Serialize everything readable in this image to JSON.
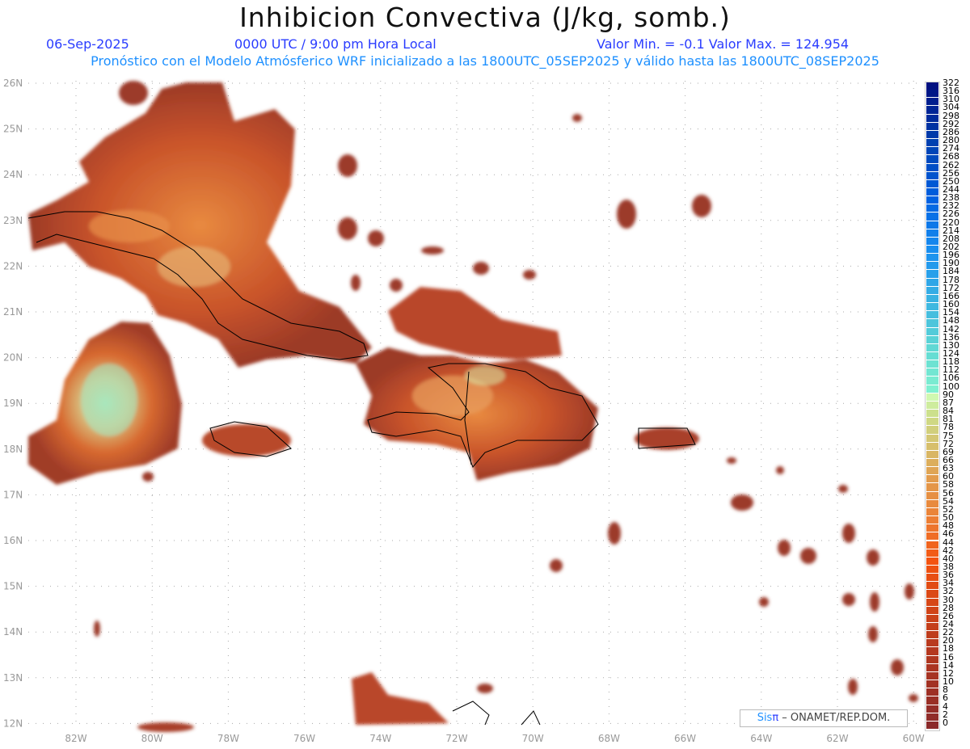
{
  "header": {
    "title": "Inhibicion Convectiva (J/kg, somb.)",
    "date": "06-Sep-2025",
    "time": "0000 UTC / 9:00 pm Hora Local",
    "minmax": "Valor Min. = -0.1  Valor Max. = 124.954",
    "subtitle": "Pronóstico con el Modelo Atmósferico WRF inicializado a las 1800UTC_05SEP2025 y válido hasta las  1800UTC_08SEP2025"
  },
  "axes": {
    "lon_labels": [
      "82W",
      "80W",
      "78W",
      "76W",
      "74W",
      "72W",
      "70W",
      "68W",
      "66W",
      "64W",
      "62W",
      "60W"
    ],
    "lat_labels": [
      "26N",
      "25N",
      "24N",
      "23N",
      "22N",
      "21N",
      "20N",
      "19N",
      "18N",
      "17N",
      "16N",
      "15N",
      "14N",
      "13N",
      "12N"
    ]
  },
  "colorbar": {
    "labels": [
      "0",
      "2",
      "4",
      "6",
      "8",
      "10",
      "12",
      "14",
      "16",
      "18",
      "20",
      "22",
      "24",
      "26",
      "28",
      "30",
      "32",
      "34",
      "36",
      "38",
      "40",
      "42",
      "44",
      "46",
      "48",
      "50",
      "52",
      "54",
      "56",
      "58",
      "60",
      "63",
      "66",
      "69",
      "72",
      "75",
      "78",
      "81",
      "84",
      "87",
      "90",
      "100",
      "106",
      "112",
      "118",
      "124",
      "130",
      "136",
      "142",
      "148",
      "154",
      "160",
      "166",
      "172",
      "178",
      "184",
      "190",
      "196",
      "202",
      "208",
      "214",
      "220",
      "226",
      "232",
      "238",
      "244",
      "250",
      "256",
      "262",
      "268",
      "274",
      "280",
      "286",
      "292",
      "298",
      "304",
      "310",
      "316",
      "322"
    ]
  },
  "credit": {
    "brand_a": "Sis",
    "brand_b": "π",
    "text": " –  ONAMET/REP.DOM."
  },
  "colors": {
    "low": "#8b2a2a",
    "mid": "#e0642a",
    "high": "#c8f0b0",
    "title_blue": "#2a3cff",
    "sub_blue": "#1e90ff"
  }
}
